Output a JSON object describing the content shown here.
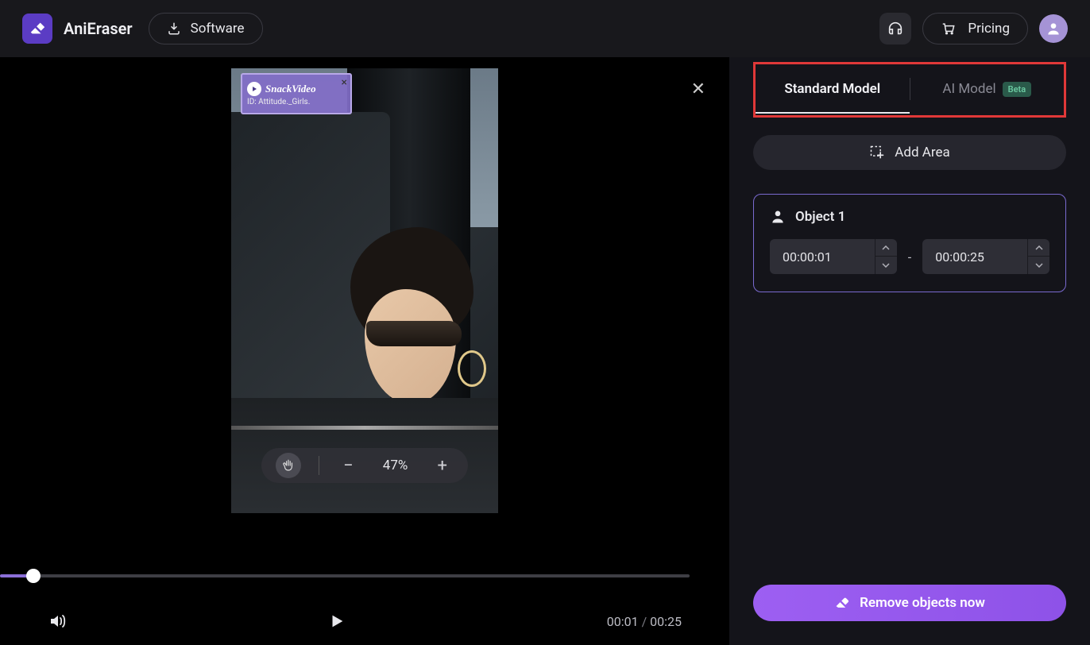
{
  "header": {
    "app_name": "AniEraser",
    "software_label": "Software",
    "pricing_label": "Pricing"
  },
  "video": {
    "watermark": {
      "brand": "SnackVideo",
      "id_line": "ID: Attitude._Girls."
    },
    "zoom_percent": "47%",
    "current_time": "00:01",
    "total_time": "00:25",
    "slider_progress_pct": 4.6
  },
  "panel": {
    "tabs": {
      "standard": "Standard Model",
      "ai": "AI Model",
      "beta": "Beta"
    },
    "add_area_label": "Add Area",
    "object": {
      "title": "Object 1",
      "start": "00:00:01",
      "end": "00:00:25"
    },
    "remove_label": "Remove objects now"
  }
}
